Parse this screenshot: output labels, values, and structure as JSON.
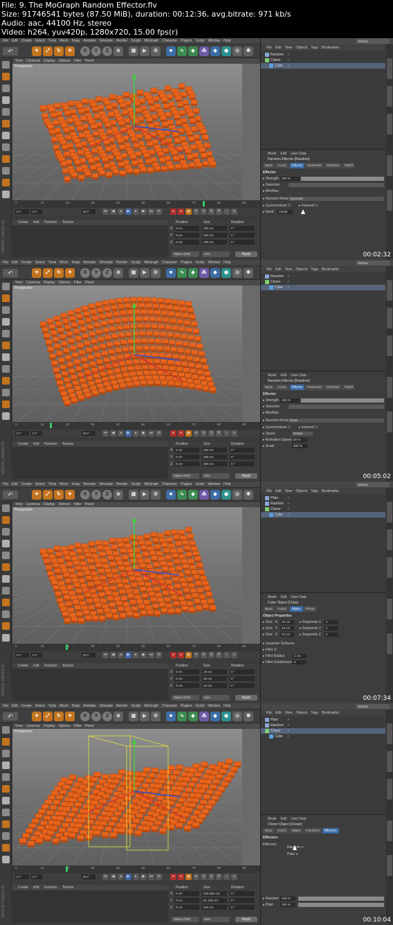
{
  "info": {
    "line1": "File: 9. The MoGraph Random Effector.flv",
    "line2": "Size: 91746541 bytes (87.50 MiB), duration: 00:12:36, avg.bitrate: 971 kb/s",
    "line3": "Audio: aac, 44100 Hz, stereo",
    "line4": "Video: h264, yuv420p, 1280x720, 15.00 fps(r)"
  },
  "app": {
    "menus": [
      "File",
      "Edit",
      "Create",
      "Select",
      "Tools",
      "Mesh",
      "Snap",
      "Animate",
      "Simulate",
      "Render",
      "Sculpt",
      "MoGraph",
      "Character",
      "Plugins",
      "Script",
      "Window",
      "Help"
    ],
    "undo_label": "↶",
    "viewport_menus": [
      "View",
      "Cameras",
      "Display",
      "Options",
      "Filter",
      "Panel"
    ],
    "viewport_label": "Perspective",
    "object_menus": [
      "File",
      "Edit",
      "View",
      "Objects",
      "Tags",
      "Bookmarks"
    ],
    "attr_menus": [
      "Mode",
      "Edit",
      "User Data"
    ],
    "layout_label": "Layout:",
    "layout_value": "Startup",
    "material_menus": [
      "Create",
      "Edit",
      "Function",
      "Texture"
    ],
    "coord_headers": [
      "Position",
      "Size",
      "Rotation"
    ],
    "coord_axes": [
      "X",
      "Y",
      "Z"
    ],
    "coord_object_mode": "Object (Rel)",
    "coord_size_mode": "Size",
    "apply_label": "Apply",
    "brand": "MAXON CINEMA 4D",
    "timeline_ticks": [
      "0",
      "10",
      "20",
      "30",
      "40",
      "50",
      "60",
      "70",
      "80",
      "90"
    ],
    "frame_start": "0 F",
    "frame_end": "90 F"
  },
  "frames": [
    {
      "timestamp": "00:02:32",
      "objects": [
        {
          "name": "Random",
          "color": "#8aa8d8",
          "indent": 0
        },
        {
          "name": "Cloner",
          "color": "#7fd06e",
          "indent": 0
        },
        {
          "name": "Cube",
          "color": "#5aa0e0",
          "indent": 1,
          "selected": true
        }
      ],
      "attr_title": "Random Effector [Random]",
      "attr_tabs": [
        "Basic",
        "Coord.",
        "Effector",
        "Parameter",
        "Deformer",
        "Falloff"
      ],
      "attr_active_tab": 2,
      "attr_section": "Effector",
      "strength_label": "Strength",
      "strength_value": "100 %",
      "selection_label": "Selection",
      "minmax_label": "Min/Max",
      "random_mode_label": "Random Mode",
      "random_mode_value": "Gaussian",
      "synchronized_label": "Synchronized",
      "indexed_label": "Indexed",
      "seed_label": "Seed",
      "seed_value": "12345",
      "coords": {
        "pos": [
          "0 cm",
          "0 cm",
          "0 cm"
        ],
        "size": [
          "200 cm",
          "200 cm",
          "200 cm"
        ],
        "rot": [
          "0 °",
          "0 °",
          "0 °"
        ]
      },
      "timeline_marker_value": 0.82
    },
    {
      "timestamp": "00:05:02",
      "objects": [
        {
          "name": "Random",
          "color": "#8aa8d8",
          "indent": 0
        },
        {
          "name": "Cloner",
          "color": "#7fd06e",
          "indent": 0
        },
        {
          "name": "Cube",
          "color": "#5aa0e0",
          "indent": 1,
          "selected": true
        }
      ],
      "attr_title": "Random Effector [Random]",
      "attr_tabs": [
        "Basic",
        "Coord.",
        "Effector",
        "Parameter",
        "Deformer",
        "Falloff"
      ],
      "attr_active_tab": 2,
      "attr_section": "Effector",
      "strength_label": "Strength",
      "strength_value": "100 %",
      "selection_label": "Selection",
      "minmax_label": "Min/Max",
      "random_mode_label": "Random Mode",
      "random_mode_value": "Noise",
      "synchronized_label": "Synchronized",
      "indexed_label": "Indexed",
      "space_label": "Space",
      "space_value": "Global",
      "anim_speed_label": "Animation Speed",
      "anim_speed_value": "50 %",
      "scale_label": "Scale",
      "scale_value": "300 %",
      "coords": {
        "pos": [
          "0 cm",
          "0 cm",
          "0 cm"
        ],
        "size": [
          "200 cm",
          "200 cm",
          "200 cm"
        ],
        "rot": [
          "0 °",
          "0 °",
          "0 °"
        ]
      },
      "timeline_marker_value": 0.15
    },
    {
      "timestamp": "00:07:34",
      "objects": [
        {
          "name": "Plain",
          "color": "#8aa8d8",
          "indent": 0
        },
        {
          "name": "Random",
          "color": "#8aa8d8",
          "indent": 0
        },
        {
          "name": "Cloner",
          "color": "#7fd06e",
          "indent": 0
        },
        {
          "name": "Cube",
          "color": "#5aa0e0",
          "indent": 1,
          "selected": true
        }
      ],
      "attr_title": "Cube Object [Cube]",
      "attr_tabs": [
        "Basic",
        "Coord.",
        "Object",
        "Phong"
      ],
      "attr_active_tab": 2,
      "attr_section": "Object Properties",
      "size_x_label": "Size . X",
      "size_x_value": "10 cm",
      "size_y_label": "Size . Y",
      "size_y_value": "10 cm",
      "size_z_label": "Size . Z",
      "size_z_value": "10 cm",
      "seg_x_label": "Segments X",
      "seg_x_value": "1",
      "seg_y_label": "Segments Y",
      "seg_y_value": "1",
      "seg_z_label": "Segments Z",
      "seg_z_value": "1",
      "separate_label": "Separate Surfaces",
      "fillet_label": "Fillet",
      "fillet_radius_label": "Fillet Radius",
      "fillet_radius_value": "1 cm",
      "fillet_sub_label": "Fillet Subdivision",
      "fillet_sub_value": "5",
      "coords": {
        "pos": [
          "0 cm",
          "0 cm",
          "0 cm"
        ],
        "size": [
          "10 cm",
          "10 cm",
          "10 cm"
        ],
        "rot": [
          "0 °",
          "0 °",
          "0 °"
        ]
      },
      "timeline_marker_value": 0.22
    },
    {
      "timestamp": "00:10:04",
      "objects": [
        {
          "name": "Plain",
          "color": "#8aa8d8",
          "indent": 0
        },
        {
          "name": "Random",
          "color": "#8aa8d8",
          "indent": 0
        },
        {
          "name": "Cloner",
          "color": "#7fd06e",
          "indent": 0,
          "selected": true
        },
        {
          "name": "Cube",
          "color": "#5aa0e0",
          "indent": 1
        }
      ],
      "attr_title": "Cloner Object [Cloner]",
      "attr_tabs": [
        "Basic",
        "Coord.",
        "Object",
        "Transform",
        "Effectors"
      ],
      "attr_active_tab": 4,
      "attr_section": "Effectors",
      "effectors_label": "Effectors",
      "effector_items": [
        "Random",
        "Plain"
      ],
      "random_weight_label": "Random",
      "random_weight_value": "100 %",
      "plain_weight_label": "Plain",
      "plain_weight_value": "100 %",
      "coords": {
        "pos": [
          "0 cm",
          "0 cm",
          "0 cm"
        ],
        "size": [
          "220.363 cm",
          "81.138 cm",
          "210 cm"
        ],
        "rot": [
          "0 °",
          "0 °",
          "0 °"
        ]
      },
      "timeline_marker_value": 0.22
    }
  ],
  "colors": {
    "accent_orange": "#e8641c",
    "ui_dark": "#3b3b3b",
    "selection_blue": "#55647a"
  }
}
